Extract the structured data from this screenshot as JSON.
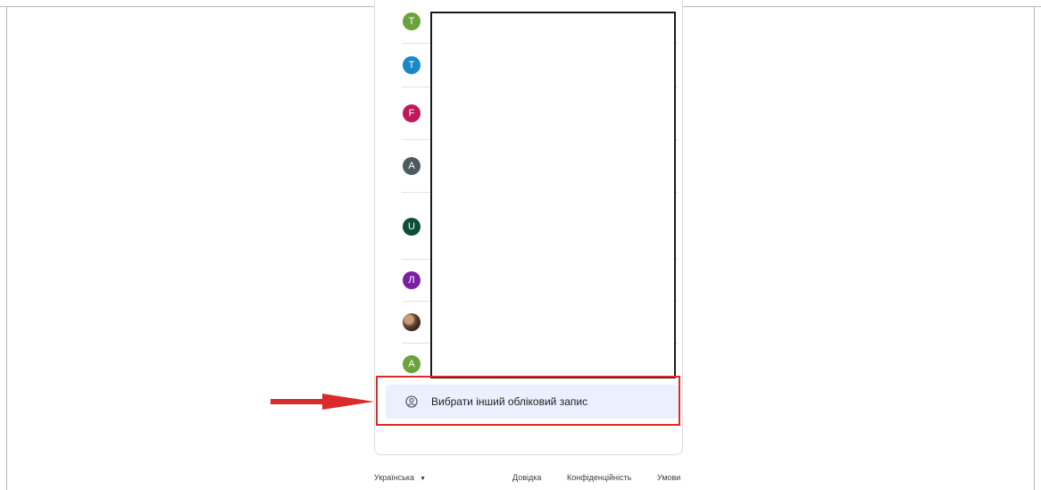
{
  "accounts": [
    {
      "initial": "T",
      "color": "#6aa33c"
    },
    {
      "initial": "T",
      "color": "#1a87c9"
    },
    {
      "initial": "F",
      "color": "#c2185b"
    },
    {
      "initial": "A",
      "color": "#4d5b61"
    },
    {
      "initial": "U",
      "color": "#0b4f3a"
    },
    {
      "initial": "Л",
      "color": "#7b1fa2"
    },
    {
      "initial": "",
      "color": "#5a3a27",
      "photo": true
    },
    {
      "initial": "A",
      "color": "#6aa33c"
    }
  ],
  "choose_account": {
    "label": "Вибрати інший обліковий запис",
    "icon": "account-circle-icon"
  },
  "annotation": {
    "highlight_color": "#d92b2b",
    "arrow_color": "#d92b2b"
  },
  "footer": {
    "language": "Українська",
    "language_icon": "caret-down-icon",
    "help": "Довідка",
    "privacy": "Конфіденційність",
    "terms": "Умови"
  }
}
